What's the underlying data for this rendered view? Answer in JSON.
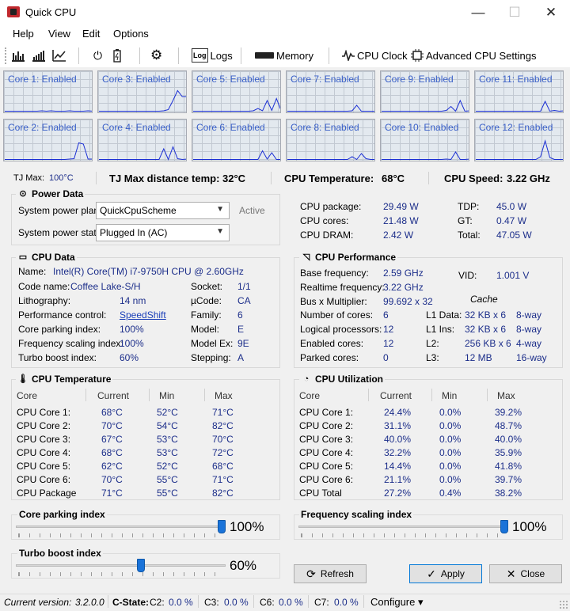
{
  "window": {
    "title": "Quick CPU",
    "minimize": "—",
    "maximize": "☐",
    "close": "✕"
  },
  "menu": [
    "Help",
    "View",
    "Edit",
    "Options"
  ],
  "toolbar": {
    "logs": "Logs",
    "memory": "Memory",
    "cpu_clock": "CPU Clock",
    "advanced": "Advanced CPU Settings"
  },
  "cores": [
    {
      "label": "Core 1: Enabled",
      "load": [
        0.03,
        0.03,
        0.03,
        0.03,
        0.03,
        0.03,
        0.03,
        0.03,
        0.04,
        0.03,
        0.04,
        0.03,
        0.03,
        0.03,
        0.04,
        0.03,
        0.03,
        0.03,
        0.04,
        0.03
      ]
    },
    {
      "label": "Core 3: Enabled",
      "load": [
        0.03,
        0.03,
        0.03,
        0.03,
        0.03,
        0.03,
        0.03,
        0.03,
        0.03,
        0.03,
        0.03,
        0.03,
        0.03,
        0.03,
        0.04,
        0.07,
        0.3,
        0.55,
        0.4,
        0.4
      ]
    },
    {
      "label": "Core 5: Enabled",
      "load": [
        0.03,
        0.03,
        0.03,
        0.03,
        0.03,
        0.03,
        0.03,
        0.03,
        0.03,
        0.03,
        0.03,
        0.03,
        0.03,
        0.04,
        0.1,
        0.04,
        0.3,
        0.05,
        0.35,
        0.05
      ]
    },
    {
      "label": "Core 7: Enabled",
      "load": [
        0.03,
        0.03,
        0.03,
        0.03,
        0.03,
        0.03,
        0.03,
        0.03,
        0.03,
        0.03,
        0.03,
        0.03,
        0.03,
        0.03,
        0.04,
        0.18,
        0.03,
        0.03,
        0.03,
        0.03
      ]
    },
    {
      "label": "Core 9: Enabled",
      "load": [
        0.03,
        0.03,
        0.03,
        0.03,
        0.03,
        0.03,
        0.03,
        0.03,
        0.03,
        0.03,
        0.03,
        0.03,
        0.03,
        0.03,
        0.05,
        0.15,
        0.03,
        0.3,
        0.03,
        0.04
      ]
    },
    {
      "label": "Core 11: Enabled",
      "load": [
        0.03,
        0.03,
        0.03,
        0.03,
        0.03,
        0.03,
        0.03,
        0.03,
        0.03,
        0.03,
        0.03,
        0.03,
        0.03,
        0.03,
        0.03,
        0.28,
        0.03,
        0.05,
        0.03,
        0.04
      ]
    },
    {
      "label": "Core 2: Enabled",
      "load": [
        0.03,
        0.03,
        0.03,
        0.03,
        0.03,
        0.03,
        0.03,
        0.03,
        0.03,
        0.03,
        0.03,
        0.03,
        0.03,
        0.03,
        0.04,
        0.05,
        0.45,
        0.42,
        0.04,
        0.04
      ]
    },
    {
      "label": "Core 4: Enabled",
      "load": [
        0.03,
        0.03,
        0.03,
        0.03,
        0.03,
        0.03,
        0.03,
        0.03,
        0.03,
        0.03,
        0.03,
        0.03,
        0.03,
        0.03,
        0.3,
        0.03,
        0.35,
        0.05,
        0.03,
        0.04
      ]
    },
    {
      "label": "Core 6: Enabled",
      "load": [
        0.03,
        0.03,
        0.03,
        0.03,
        0.03,
        0.03,
        0.03,
        0.03,
        0.03,
        0.03,
        0.03,
        0.03,
        0.03,
        0.03,
        0.03,
        0.25,
        0.04,
        0.2,
        0.03,
        0.03
      ]
    },
    {
      "label": "Core 8: Enabled",
      "load": [
        0.03,
        0.03,
        0.03,
        0.03,
        0.03,
        0.03,
        0.03,
        0.03,
        0.03,
        0.03,
        0.03,
        0.03,
        0.03,
        0.03,
        0.1,
        0.03,
        0.18,
        0.05,
        0.03,
        0.03
      ]
    },
    {
      "label": "Core 10: Enabled",
      "load": [
        0.03,
        0.03,
        0.03,
        0.03,
        0.03,
        0.03,
        0.03,
        0.03,
        0.03,
        0.03,
        0.03,
        0.03,
        0.03,
        0.03,
        0.04,
        0.03,
        0.22,
        0.03,
        0.03,
        0.04
      ]
    },
    {
      "label": "Core 12: Enabled",
      "load": [
        0.03,
        0.03,
        0.03,
        0.03,
        0.03,
        0.03,
        0.03,
        0.03,
        0.03,
        0.03,
        0.03,
        0.03,
        0.03,
        0.03,
        0.1,
        0.5,
        0.08,
        0.03,
        0.03,
        0.03
      ]
    }
  ],
  "stats": {
    "tjmax_label": "TJ Max:",
    "tjmax_value": "100°C",
    "dist_label": "TJ Max distance temp:",
    "dist_value": "32°C",
    "temp_label": "CPU Temperature:",
    "temp_value": "68°C",
    "speed_label": "CPU Speed:",
    "speed_value": "3.22 GHz"
  },
  "power": {
    "title": "Power Data",
    "plan_label": "System power plan:",
    "plan_value": "QuickCpuScheme",
    "plan_status": "Active",
    "state_label": "System power state:",
    "state_value": "Plugged In (AC)",
    "left": [
      {
        "k": "CPU package:",
        "v": "29.49 W"
      },
      {
        "k": "CPU cores:",
        "v": "21.48 W"
      },
      {
        "k": "CPU DRAM:",
        "v": "2.42 W"
      }
    ],
    "right": [
      {
        "k": "TDP:",
        "v": "45.0 W"
      },
      {
        "k": "GT:",
        "v": "0.47 W"
      },
      {
        "k": "Total:",
        "v": "47.05 W"
      }
    ]
  },
  "cpu": {
    "title": "CPU Data",
    "name_label": "Name:",
    "name_value": "Intel(R) Core(TM) i7-9750H CPU @ 2.60GHz",
    "left": [
      {
        "k": "Code name:",
        "v": "Coffee Lake-S/H"
      },
      {
        "k": "Lithography:",
        "v": "14 nm"
      },
      {
        "k": "Performance control:",
        "v": "SpeedShift"
      },
      {
        "k": "Core parking index:",
        "v": "100%"
      },
      {
        "k": "Frequency scaling index:",
        "v": "100%"
      },
      {
        "k": "Turbo boost index:",
        "v": "60%"
      }
    ],
    "right": [
      {
        "k": "Socket:",
        "v": "1/1"
      },
      {
        "k": "µCode:",
        "v": "CA"
      },
      {
        "k": "Family:",
        "v": "6"
      },
      {
        "k": "Model:",
        "v": "E"
      },
      {
        "k": "Model Ex:",
        "v": "9E"
      },
      {
        "k": "Stepping:",
        "v": "A"
      }
    ]
  },
  "perf": {
    "title": "CPU Performance",
    "base_label": "Base frequency:",
    "base_value": "2.59 GHz",
    "vid_label": "VID:",
    "vid_value": "1.001 V",
    "rt_label": "Realtime frequency:",
    "rt_value": "3.22 GHz",
    "bus_label": "Bus x Multiplier:",
    "bus_value": "99.692 x 32",
    "cache_label": "Cache",
    "left": [
      {
        "k": "Number of cores:",
        "v": "6"
      },
      {
        "k": "Logical processors:",
        "v": "12"
      },
      {
        "k": "Enabled cores:",
        "v": "12"
      },
      {
        "k": "Parked cores:",
        "v": "0"
      }
    ],
    "cache": [
      {
        "k": "L1 Data:",
        "v": "32 KB x 6",
        "w": "8-way"
      },
      {
        "k": "L1 Ins:",
        "v": "32 KB x 6",
        "w": "8-way"
      },
      {
        "k": "L2:",
        "v": "256 KB x 6",
        "w": "4-way"
      },
      {
        "k": "L3:",
        "v": "12 MB",
        "w": "16-way"
      }
    ]
  },
  "temperature": {
    "title": "CPU Temperature",
    "headers": [
      "Core",
      "Current",
      "Min",
      "Max"
    ],
    "rows": [
      [
        "CPU Core 1:",
        "68°C",
        "52°C",
        "71°C"
      ],
      [
        "CPU Core 2:",
        "70°C",
        "54°C",
        "82°C"
      ],
      [
        "CPU Core 3:",
        "67°C",
        "53°C",
        "70°C"
      ],
      [
        "CPU Core 4:",
        "68°C",
        "53°C",
        "72°C"
      ],
      [
        "CPU Core 5:",
        "62°C",
        "52°C",
        "68°C"
      ],
      [
        "CPU Core 6:",
        "70°C",
        "55°C",
        "71°C"
      ],
      [
        "CPU Package",
        "71°C",
        "55°C",
        "82°C"
      ]
    ]
  },
  "utilization": {
    "title": "CPU Utilization",
    "headers": [
      "Core",
      "Current",
      "Min",
      "Max"
    ],
    "rows": [
      [
        "CPU Core 1:",
        "24.4%",
        "0.0%",
        "39.2%"
      ],
      [
        "CPU Core 2:",
        "31.1%",
        "0.0%",
        "48.7%"
      ],
      [
        "CPU Core 3:",
        "40.0%",
        "0.0%",
        "40.0%"
      ],
      [
        "CPU Core 4:",
        "32.2%",
        "0.0%",
        "35.9%"
      ],
      [
        "CPU Core 5:",
        "14.4%",
        "0.0%",
        "41.8%"
      ],
      [
        "CPU Core 6:",
        "21.1%",
        "0.0%",
        "39.7%"
      ],
      [
        "CPU Total",
        "27.2%",
        "0.4%",
        "38.2%"
      ]
    ]
  },
  "sliders": {
    "parking": {
      "label": "Core parking index",
      "value": "100%",
      "fraction": 1.0
    },
    "scaling": {
      "label": "Frequency scaling index",
      "value": "100%",
      "fraction": 1.0
    },
    "turbo": {
      "label": "Turbo boost index",
      "value": "60%",
      "fraction": 0.6
    }
  },
  "buttons": {
    "refresh": "Refresh",
    "apply": "Apply",
    "close": "Close"
  },
  "status": {
    "version_label": "Current version:",
    "version": "3.2.0.0",
    "cstate": "C-State:",
    "c2": "C2:",
    "c2v": "0.0 %",
    "c3": "C3:",
    "c3v": "0.0 %",
    "c6": "C6:",
    "c6v": "0.0 %",
    "c7": "C7:",
    "c7v": "0.0 %",
    "configure": "Configure ▾"
  },
  "colors": {
    "accent": "#1a73d9",
    "value_blue": "#1c2e8a",
    "graph_line": "#1b2fd4",
    "core_label": "#3a60c8"
  }
}
